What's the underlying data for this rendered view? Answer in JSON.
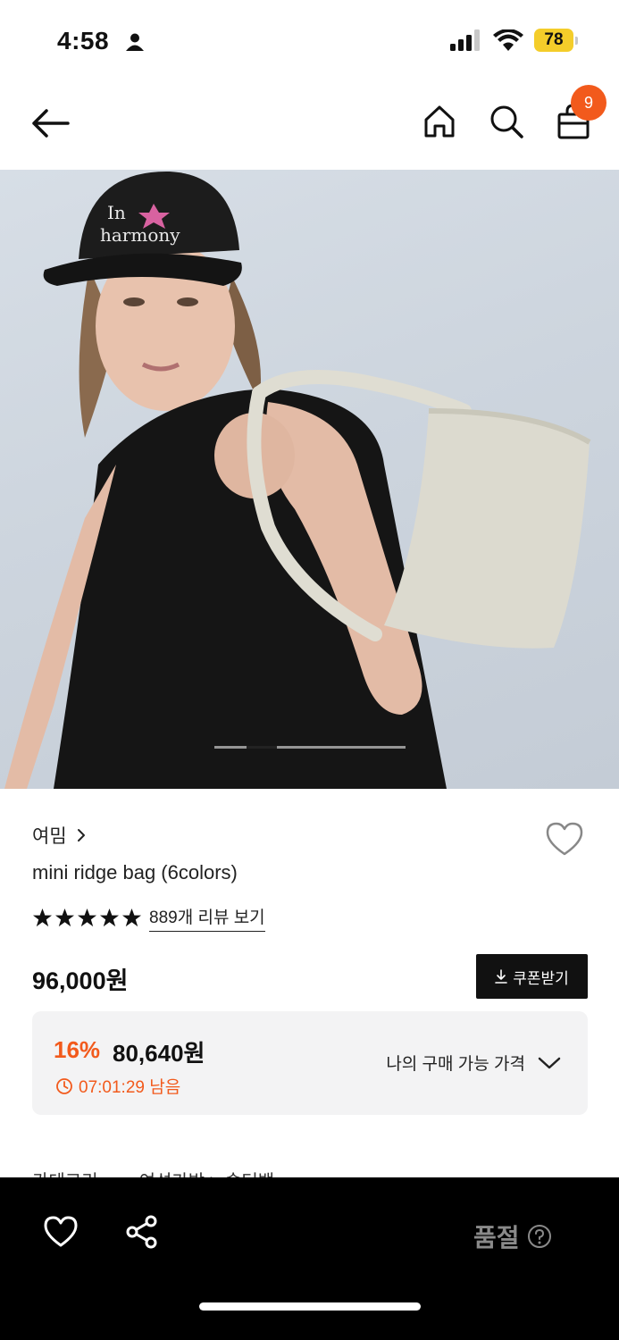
{
  "status_bar": {
    "time": "4:58",
    "battery": "78"
  },
  "nav": {
    "cart_count": "9"
  },
  "product": {
    "brand": "여밈",
    "name": "mini ridge bag (6colors)",
    "review_link": "889개 리뷰 보기",
    "rating_stars": 5,
    "original_price": "96,000원",
    "coupon_label": "쿠폰받기",
    "discount_rate": "16%",
    "discount_price": "80,640원",
    "timer": "07:01:29 남음",
    "my_price_label": "나의 구매 가능 가격"
  },
  "category": {
    "label": "카테고리",
    "path": "여성가방 > 숄더백"
  },
  "image_carousel": {
    "total": 6,
    "active_index": 1
  },
  "bottom_bar": {
    "soldout_label": "품절"
  },
  "colors": {
    "accent": "#f25a1c",
    "badge": "#f25a1c",
    "battery": "#f4cd2a"
  }
}
